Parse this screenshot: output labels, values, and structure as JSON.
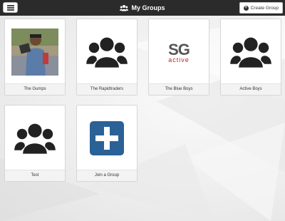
{
  "header": {
    "title": "My Groups",
    "menu_icon": "hamburger-menu-icon",
    "title_icon": "group-icon",
    "create_button_label": "Create Group",
    "create_button_icon": "plus-circle-icon",
    "bar_color": "#2b2b2b"
  },
  "groups": [
    {
      "name": "The Gumps",
      "image": "photo"
    },
    {
      "name": "The Rapidtraders",
      "image": "group-icon"
    },
    {
      "name": "The Blue Boys",
      "image": "sg-active-logo"
    },
    {
      "name": "Active Boys",
      "image": "group-icon"
    },
    {
      "name": "Test",
      "image": "group-icon"
    },
    {
      "name": "Join a Group",
      "image": "plus-square-icon"
    }
  ],
  "logo": {
    "main": "SG",
    "sub": "active"
  },
  "colors": {
    "join_icon": "#2a6196",
    "logo_sub": "#b22a2a"
  }
}
